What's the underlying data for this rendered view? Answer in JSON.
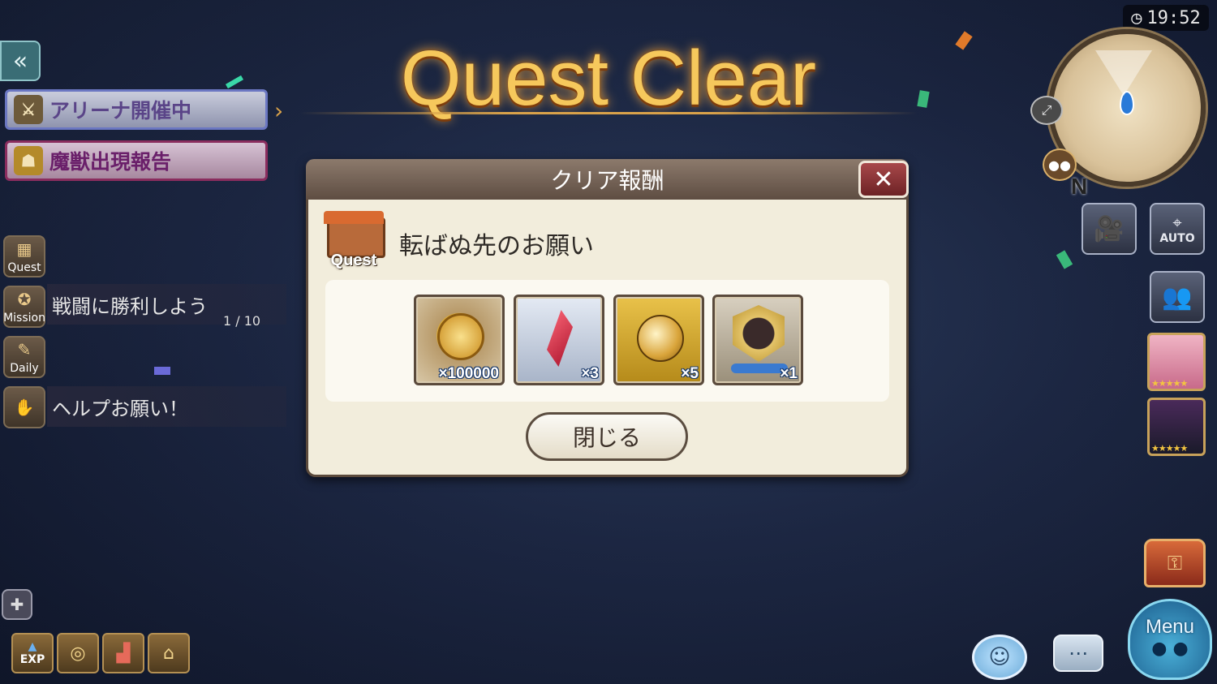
{
  "hud": {
    "clock": "19:52",
    "compass_label": "N",
    "back_icon": "double-chevron-left-icon"
  },
  "banners": [
    {
      "label": "アリーナ開催中",
      "icon": "arena-icon"
    },
    {
      "label": "魔獣出現報告",
      "icon": "beast-icon"
    }
  ],
  "side_menu": {
    "quest_label": "Quest",
    "mission_label": "Mission",
    "mission_text": "戦闘に勝利しよう",
    "mission_progress": "1 / 10",
    "daily_label": "Daily",
    "help_text": "ヘルプお願い！"
  },
  "title": "Quest Clear",
  "dialog": {
    "header": "クリア報酬",
    "quest_icon_label": "Quest",
    "quest_name": "転ばぬ先のお願い",
    "rewards": [
      {
        "name": "gold-coin",
        "qty": "×100000"
      },
      {
        "name": "red-crystal",
        "qty": "×3"
      },
      {
        "name": "golden-orb",
        "qty": "×5"
      },
      {
        "name": "character-medal",
        "qty": "×1"
      }
    ],
    "close_button": "閉じる"
  },
  "right_buttons": {
    "auto_label": "AUTO",
    "menu_label": "Menu"
  },
  "bottom_left": {
    "exp_label": "EXP"
  },
  "colors": {
    "title_gold": "#f6c85c",
    "dialog_bg": "#f2eddc",
    "close_red": "#a8484a"
  }
}
